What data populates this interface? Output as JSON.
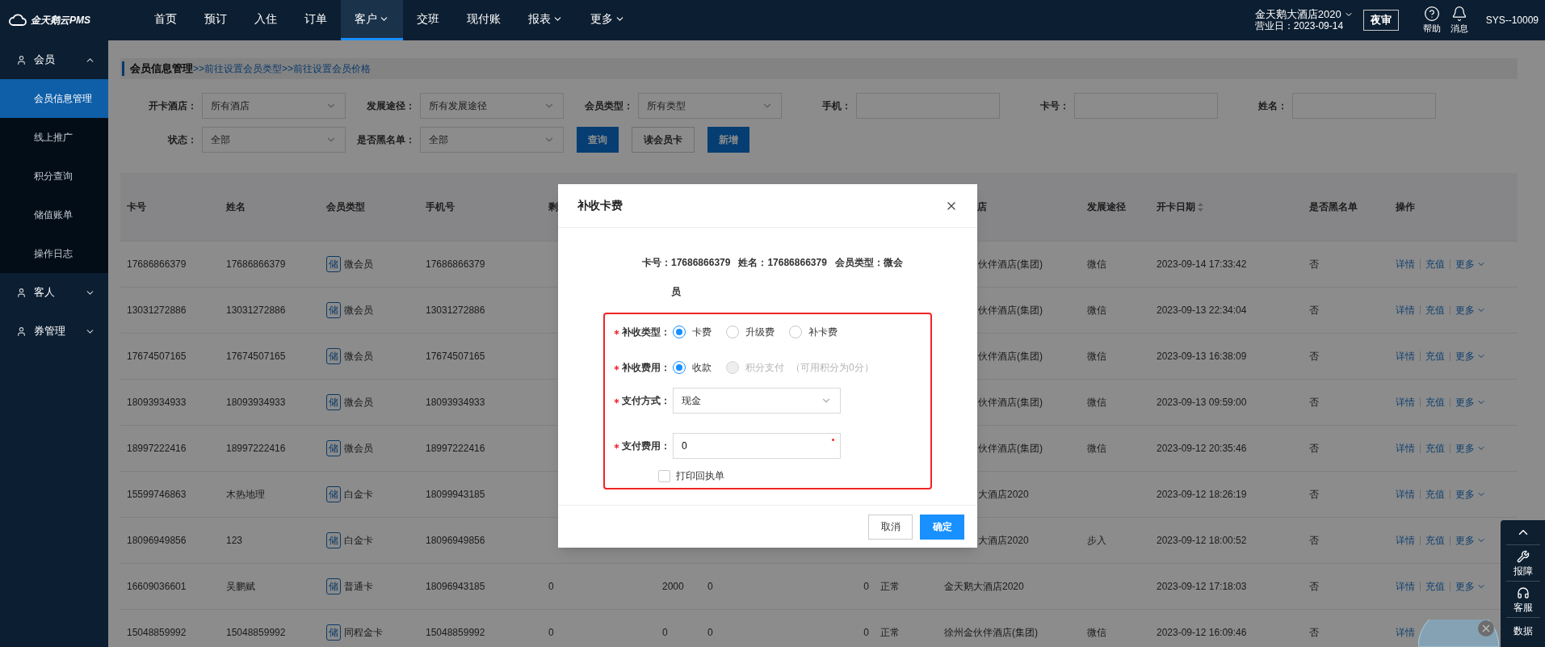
{
  "topbar": {
    "logo": "金天鹅云PMS",
    "nav": [
      {
        "label": "首页",
        "selected": false,
        "dropdown": false
      },
      {
        "label": "预订",
        "selected": false,
        "dropdown": false
      },
      {
        "label": "入住",
        "selected": false,
        "dropdown": false
      },
      {
        "label": "订单",
        "selected": false,
        "dropdown": false
      },
      {
        "label": "客户",
        "selected": true,
        "dropdown": true
      },
      {
        "label": "交班",
        "selected": false,
        "dropdown": false
      },
      {
        "label": "现付账",
        "selected": false,
        "dropdown": false
      },
      {
        "label": "报表",
        "selected": false,
        "dropdown": true
      },
      {
        "label": "更多",
        "selected": false,
        "dropdown": true
      }
    ],
    "hotel": "金天鹅大酒店2020",
    "business_day": "营业日：2023-09-14",
    "night_audit": "夜审",
    "help": "帮助",
    "messages": "消息",
    "user": "SYS--10009"
  },
  "sidebar": [
    {
      "label": "会员",
      "expanded": true,
      "children": [
        {
          "label": "会员信息管理",
          "selected": true
        },
        {
          "label": "线上推广",
          "selected": false
        },
        {
          "label": "积分查询",
          "selected": false
        },
        {
          "label": "储值账单",
          "selected": false
        },
        {
          "label": "操作日志",
          "selected": false
        }
      ]
    },
    {
      "label": "客人",
      "expanded": false
    },
    {
      "label": "券管理",
      "expanded": false
    }
  ],
  "breadcrumb": {
    "title": "会员信息管理",
    "links": [
      ">>前往设置会员类型",
      ">>前往设置会员价格"
    ]
  },
  "filter_rows": [
    [
      {
        "label": "开卡酒店：",
        "kind": "select",
        "value": "所有酒店"
      },
      {
        "label": "发展途径：",
        "kind": "select",
        "value": "所有发展途径"
      },
      {
        "label": "会员类型：",
        "kind": "select",
        "value": "所有类型"
      },
      {
        "label": "手机：",
        "kind": "input"
      },
      {
        "label": "卡号：",
        "kind": "input"
      },
      {
        "label": "姓名：",
        "kind": "input"
      }
    ],
    [
      {
        "label": "状态：",
        "kind": "select",
        "value": "全部"
      },
      {
        "label": "是否黑名单：",
        "kind": "select",
        "value": "全部"
      }
    ]
  ],
  "buttons": [
    {
      "label": "查询",
      "primary": true
    },
    {
      "label": "读会员卡",
      "primary": false
    },
    {
      "label": "新增",
      "primary": true
    }
  ],
  "table": {
    "columns": [
      {
        "label": "卡号"
      },
      {
        "label": "姓名"
      },
      {
        "label": "会员类型"
      },
      {
        "label": "手机号"
      },
      {
        "label": "剩"
      },
      {
        "label": "店",
        "partial": true
      },
      {
        "label": "发展途径"
      },
      {
        "label": "开卡日期",
        "sortable": true
      },
      {
        "label": "是否黑名单"
      },
      {
        "label": "操作"
      }
    ],
    "rows": [
      {
        "card": "17686866379",
        "name": "17686866379",
        "badge": "储",
        "type": "微会员",
        "phone": "17686866379",
        "hotel": {
          "text": "伙伴酒店(集团)",
          "partial": true
        },
        "channel": "微信",
        "opened": "2023-09-14 17:33:42",
        "blacklist": "否",
        "actions": [
          {
            "label": "详情",
            "kind": "link"
          },
          {
            "label": "充值",
            "kind": "link"
          },
          {
            "label": "更多",
            "kind": "menu"
          }
        ]
      },
      {
        "card": "13031272886",
        "name": "13031272886",
        "badge": "储",
        "type": "微会员",
        "phone": "13031272886",
        "hotel": {
          "text": "伙伴酒店(集团)",
          "partial": true
        },
        "channel": "微信",
        "opened": "2023-09-13 22:34:04",
        "blacklist": "否",
        "actions": [
          {
            "label": "详情",
            "kind": "link"
          },
          {
            "label": "充值",
            "kind": "link"
          },
          {
            "label": "更多",
            "kind": "menu"
          }
        ]
      },
      {
        "card": "17674507165",
        "name": "17674507165",
        "badge": "储",
        "type": "微会员",
        "phone": "17674507165",
        "hotel": {
          "text": "伙伴酒店(集团)",
          "partial": true
        },
        "channel": "微信",
        "opened": "2023-09-13 16:38:09",
        "blacklist": "否",
        "actions": [
          {
            "label": "详情",
            "kind": "link"
          },
          {
            "label": "充值",
            "kind": "link"
          },
          {
            "label": "更多",
            "kind": "menu"
          }
        ]
      },
      {
        "card": "18093934933",
        "name": "18093934933",
        "badge": "储",
        "type": "微会员",
        "phone": "18093934933",
        "hotel": {
          "text": "伙伴酒店(集团)",
          "partial": true
        },
        "channel": "微信",
        "opened": "2023-09-13 09:59:00",
        "blacklist": "否",
        "actions": [
          {
            "label": "详情",
            "kind": "link"
          },
          {
            "label": "充值",
            "kind": "link"
          },
          {
            "label": "更多",
            "kind": "menu"
          }
        ]
      },
      {
        "card": "18997222416",
        "name": "18997222416",
        "badge": "储",
        "type": "微会员",
        "phone": "18997222416",
        "hotel": {
          "text": "伙伴酒店(集团)",
          "partial": true
        },
        "channel": "微信",
        "opened": "2023-09-12 20:35:46",
        "blacklist": "否",
        "actions": [
          {
            "label": "详情",
            "kind": "link"
          },
          {
            "label": "充值",
            "kind": "link"
          },
          {
            "label": "更多",
            "kind": "menu"
          }
        ]
      },
      {
        "card": "15599746863",
        "name": "木热地理",
        "badge": "储",
        "type": "白金卡",
        "phone": "18099943185",
        "hotel": {
          "text": "大酒店2020",
          "partial": true
        },
        "opened": "2023-09-12 18:26:19",
        "blacklist": "否",
        "actions": [
          {
            "label": "详情",
            "kind": "link"
          },
          {
            "label": "充值",
            "kind": "link"
          },
          {
            "label": "更多",
            "kind": "menu"
          }
        ]
      },
      {
        "card": "18096949856",
        "name": "123",
        "badge": "储",
        "type": "白金卡",
        "phone": "18096949856",
        "hotel": {
          "text": "大酒店2020",
          "partial": true
        },
        "channel": "步入",
        "opened": "2023-09-12 18:00:52",
        "blacklist": "否",
        "actions": [
          {
            "label": "详情",
            "kind": "link"
          },
          {
            "label": "充值",
            "kind": "link"
          },
          {
            "label": "更多",
            "kind": "menu"
          }
        ]
      },
      {
        "card": "16609036601",
        "name": "吴鹏赋",
        "badge": "储",
        "type": "普通卡",
        "phone": "18096943185",
        "amounts": [
          "0",
          "2000",
          "0",
          "0"
        ],
        "status": "正常",
        "hotel": {
          "text": "金天鹅大酒店2020"
        },
        "opened": "2023-09-12 17:18:03",
        "blacklist": "否",
        "actions": [
          {
            "label": "详情",
            "kind": "link"
          },
          {
            "label": "充值",
            "kind": "link"
          },
          {
            "label": "更多",
            "kind": "menu"
          }
        ]
      },
      {
        "card": "15048859992",
        "name": "15048859992",
        "badge": "储",
        "type": "同程金卡",
        "phone": "15048859992",
        "amounts": [
          "0",
          "0",
          "0",
          "0"
        ],
        "status": "正常",
        "hotel": {
          "text": "徐州金伙伴酒店(集团)"
        },
        "channel": "微信",
        "opened": "2023-09-12 16:09:46",
        "blacklist": "否",
        "actions": [
          {
            "label": "详情",
            "kind": "link"
          }
        ]
      }
    ]
  },
  "modal": {
    "title": "补收卡费",
    "info": {
      "card_label": "卡号：",
      "card": "17686866379",
      "name_label": "姓名：",
      "name": "17686866379",
      "type_label": "会员类型：",
      "type": "微会员"
    },
    "fields": [
      {
        "kind": "radio",
        "label": "补收类型：",
        "required": true,
        "options": [
          {
            "label": "卡费",
            "selected": true,
            "disabled": false
          },
          {
            "label": "升级费",
            "selected": false,
            "disabled": false
          },
          {
            "label": "补卡费",
            "selected": false,
            "disabled": false
          }
        ]
      },
      {
        "kind": "radio",
        "label": "补收费用：",
        "required": true,
        "options": [
          {
            "label": "收款",
            "selected": true,
            "disabled": false
          },
          {
            "label": "积分支付",
            "selected": false,
            "disabled": true
          }
        ],
        "note": "（可用积分为0分）"
      },
      {
        "kind": "select",
        "label": "支付方式：",
        "required": true,
        "value": "现金"
      },
      {
        "kind": "input",
        "label": "支付费用：",
        "required": true,
        "value": "0"
      }
    ],
    "print_receipt": {
      "label": "打印回执单",
      "checked": false
    },
    "cancel": "取消",
    "confirm": "确定"
  },
  "float_tools": [
    {
      "kind": "top"
    },
    {
      "kind": "repair",
      "label": "报障"
    },
    {
      "kind": "support",
      "label": "客服"
    },
    {
      "kind": "data",
      "label": "数据"
    }
  ]
}
